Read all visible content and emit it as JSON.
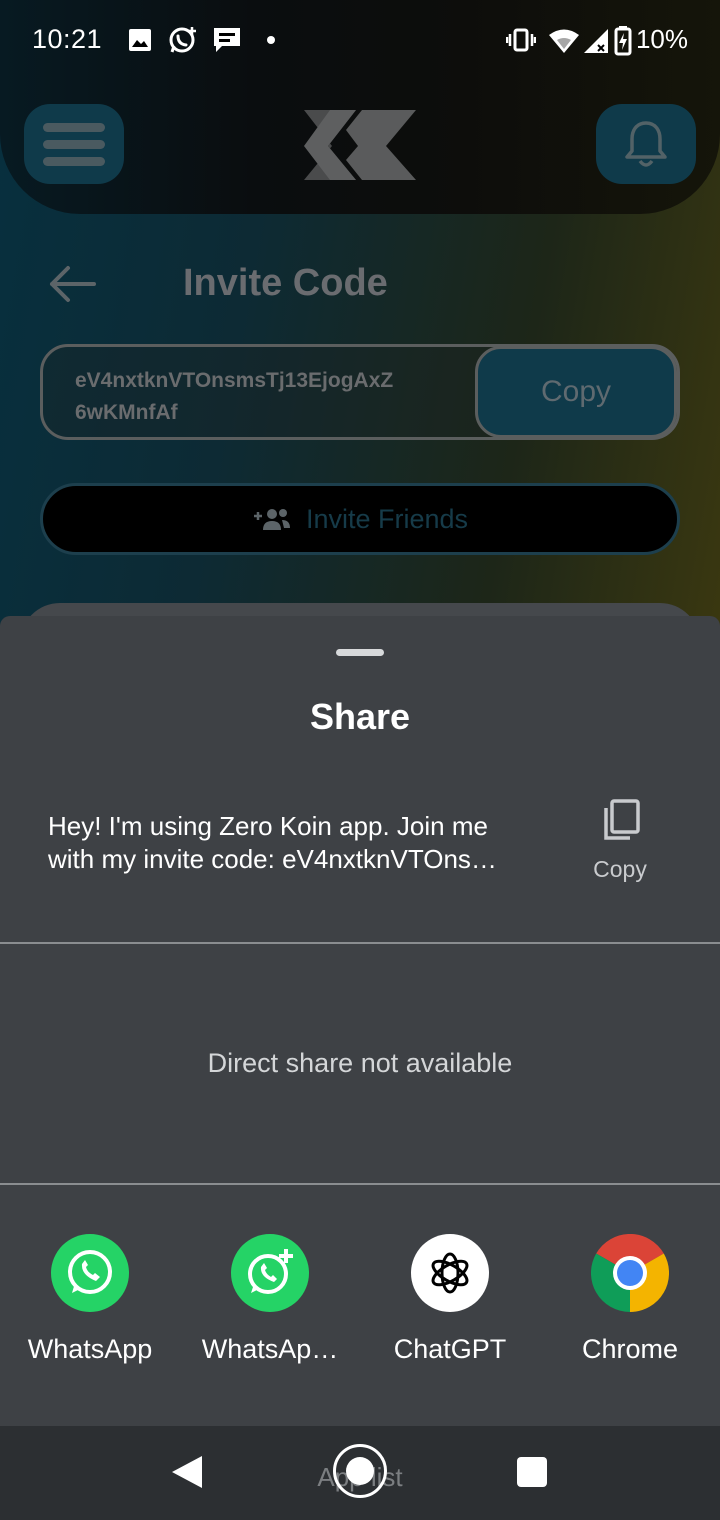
{
  "status_bar": {
    "time": "10:21",
    "battery": "10%",
    "icons": [
      "image-icon",
      "whatsapp-notification-icon",
      "message-icon",
      "dot-icon",
      "vibrate-icon",
      "wifi-icon",
      "signal-icon",
      "battery-icon"
    ]
  },
  "header": {
    "menu_icon": "hamburger-menu-icon",
    "logo_icon": "zk-logo-icon",
    "bell_icon": "bell-icon"
  },
  "page": {
    "title": "Invite Code",
    "invite_code_line1": "eV4nxtknVTOnsmsTj13EjogAxZ",
    "invite_code_line2": "6wKMnfAf",
    "copy_label": "Copy",
    "invite_friends_label": "Invite Friends"
  },
  "share_sheet": {
    "title": "Share",
    "message_line1": "Hey! I'm using Zero Koin app. Join me",
    "message_line2": "with my invite code: eV4nxtknVTOns…",
    "copy_label": "Copy",
    "direct_share_text": "Direct share not available",
    "apps": [
      {
        "label": "WhatsApp",
        "icon": "whatsapp-icon",
        "color": "#25d366"
      },
      {
        "label": "WhatsAp…",
        "icon": "whatsapp-business-icon",
        "color": "#25d366"
      },
      {
        "label": "ChatGPT",
        "icon": "chatgpt-icon",
        "color": "#ffffff"
      },
      {
        "label": "Chrome",
        "icon": "chrome-icon",
        "color": "#4285f4"
      }
    ]
  },
  "nav_bar": {
    "app_list_label": "App list"
  },
  "colors": {
    "accent": "#0f3a4a",
    "sheet_bg": "#3e4145"
  }
}
